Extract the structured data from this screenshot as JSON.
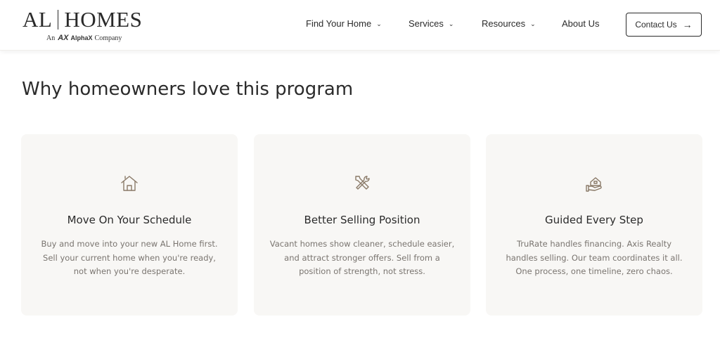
{
  "brand": {
    "left": "AL",
    "right": "HOMES",
    "sub_prefix": "An",
    "sub_mark": "AX",
    "sub_name": "AlphaX",
    "sub_suffix": "Company"
  },
  "nav": {
    "items": [
      {
        "label": "Find Your Home",
        "has_dropdown": true
      },
      {
        "label": "Services",
        "has_dropdown": true
      },
      {
        "label": "Resources",
        "has_dropdown": true
      },
      {
        "label": "About Us",
        "has_dropdown": false
      }
    ],
    "contact_label": "Contact Us",
    "contact_icon": "arrow-right-icon"
  },
  "section": {
    "title": "Why homeowners love this program"
  },
  "cards": [
    {
      "icon": "house-icon",
      "title": "Move On Your Schedule",
      "text": "Buy and move into your new AL Home first. Sell your current home when you're ready, not when you're desperate."
    },
    {
      "icon": "tools-icon",
      "title": "Better Selling Position",
      "text": "Vacant homes show cleaner, schedule easier, and attract stronger offers. Sell from a position of strength, not stress."
    },
    {
      "icon": "hand-house-icon",
      "title": "Guided Every Step",
      "text": "TruRate handles financing. Axis Realty handles selling. Our team coordinates it all. One process, one timeline, zero chaos."
    }
  ],
  "colors": {
    "icon": "#8a7a68",
    "card_bg": "#f8f7f5",
    "body_text": "#7a7570"
  }
}
